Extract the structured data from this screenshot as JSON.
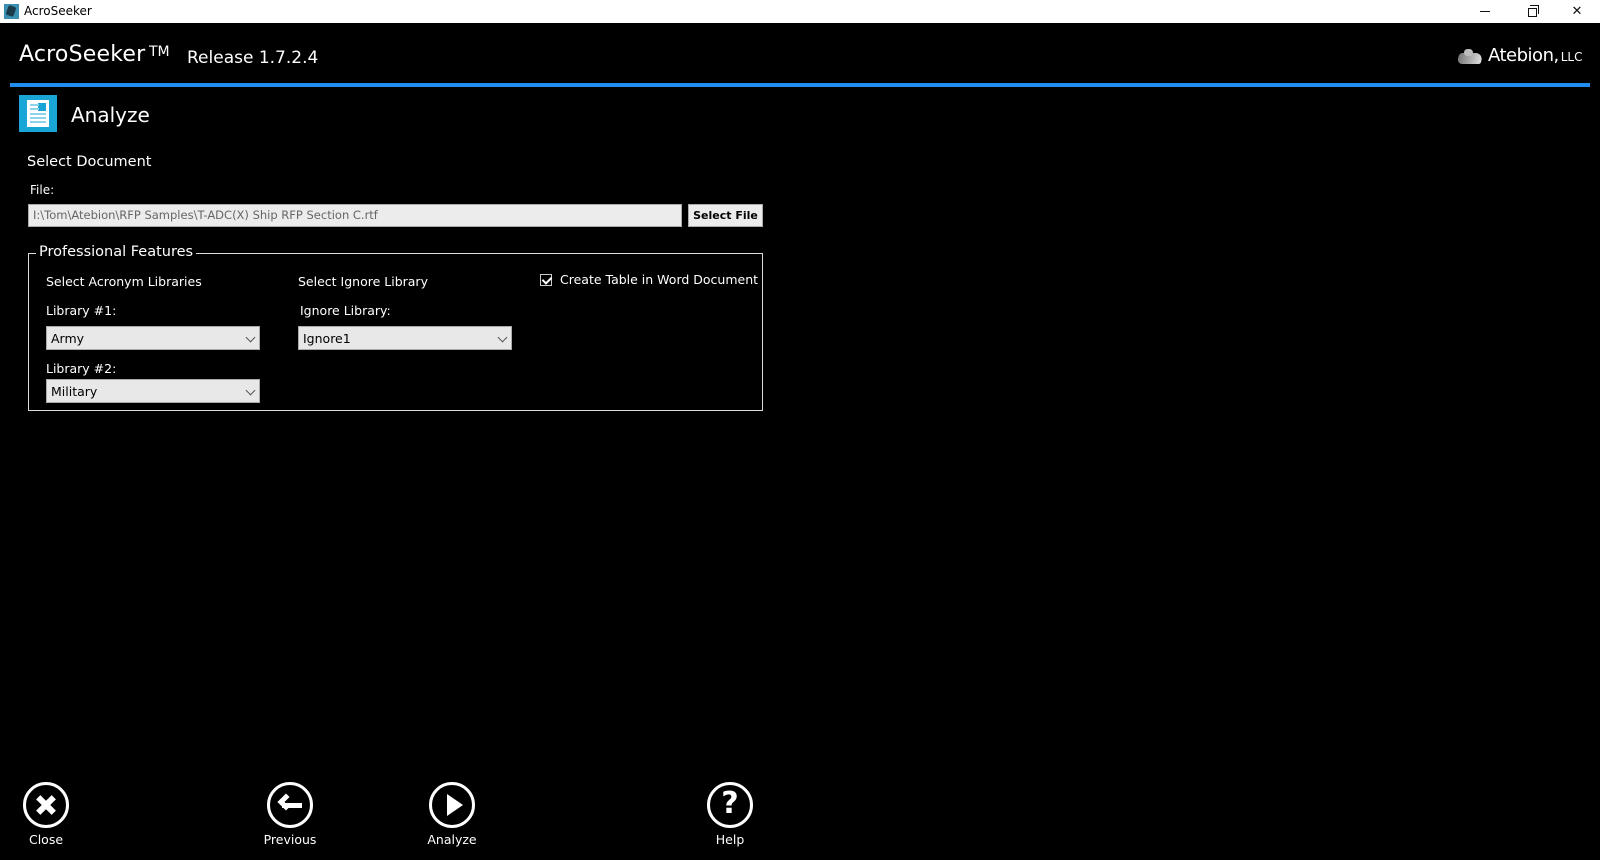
{
  "window": {
    "title": "AcroSeeker",
    "controls": {
      "minimize": "minimize",
      "restore": "restore",
      "close": "close"
    }
  },
  "header": {
    "app_name": "AcroSeeker",
    "trademark": "TM",
    "release": "Release 1.7.2.4",
    "brand_name": "Atebion,",
    "brand_suffix": "LLC",
    "accent_color": "#1e8ff0"
  },
  "page": {
    "icon": "document-icon",
    "title": "Analyze",
    "icon_color": "#19a6d6"
  },
  "select_document": {
    "heading": "Select Document",
    "file_label": "File:",
    "file_value": "I:\\Tom\\Atebion\\RFP Samples\\T-ADC(X) Ship RFP Section C.rtf",
    "select_file_label": "Select File"
  },
  "professional_features": {
    "legend": "Professional Features",
    "acronym_libraries": {
      "heading": "Select Acronym Libraries",
      "library1_label": "Library #1:",
      "library1_value": "Army",
      "library2_label": "Library #2:",
      "library2_value": "Military"
    },
    "ignore_library": {
      "heading": "Select Ignore Library",
      "label": "Ignore Library:",
      "value": "Ignore1"
    },
    "create_table": {
      "label": "Create Table in Word Document",
      "checked": true
    }
  },
  "toolbar": {
    "close_label": "Close",
    "previous_label": "Previous",
    "analyze_label": "Analyze",
    "help_label": "Help",
    "help_glyph": "?"
  }
}
